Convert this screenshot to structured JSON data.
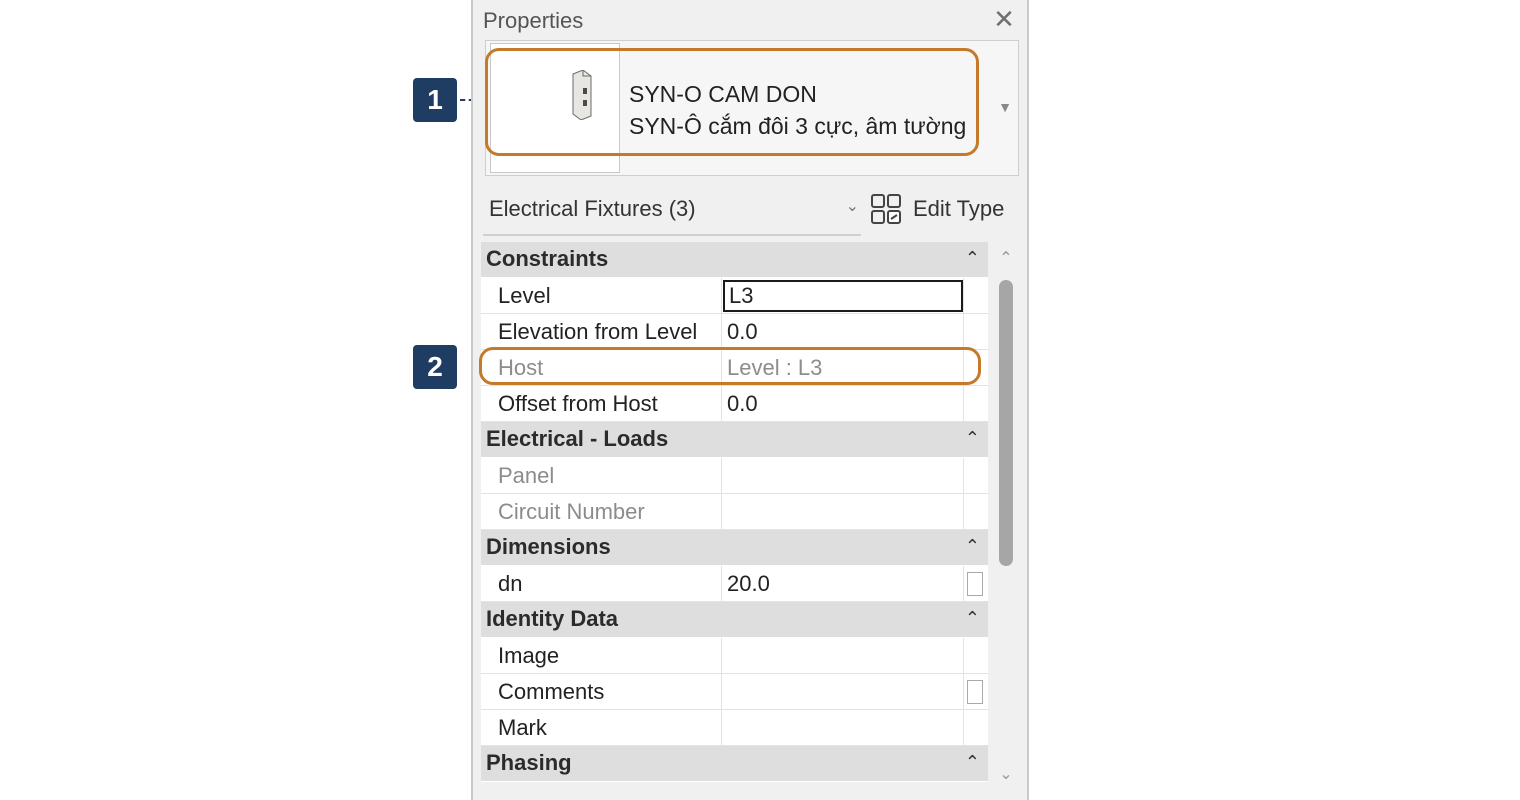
{
  "panel": {
    "title": "Properties",
    "close_symbol": "✕"
  },
  "type_selector": {
    "family_name": "SYN-O CAM DON",
    "type_name": "SYN-Ô cắm đôi 3 cực, âm tường"
  },
  "filter": {
    "label": "Electrical Fixtures (3)",
    "edit_type_label": "Edit Type"
  },
  "sections": {
    "constraints": {
      "label": "Constraints"
    },
    "electrical_loads": {
      "label": "Electrical - Loads"
    },
    "dimensions": {
      "label": "Dimensions"
    },
    "identity_data": {
      "label": "Identity Data"
    },
    "phasing": {
      "label": "Phasing"
    }
  },
  "rows": {
    "level": {
      "label": "Level",
      "value": "L3"
    },
    "elevation": {
      "label": "Elevation from Level",
      "value": "0.0"
    },
    "host": {
      "label": "Host",
      "value": "Level : L3"
    },
    "offset": {
      "label": "Offset from Host",
      "value": "0.0"
    },
    "panel": {
      "label": "Panel",
      "value": ""
    },
    "circuit": {
      "label": "Circuit Number",
      "value": ""
    },
    "dn": {
      "label": "dn",
      "value": "20.0"
    },
    "image": {
      "label": "Image",
      "value": ""
    },
    "comments": {
      "label": "Comments",
      "value": ""
    },
    "mark": {
      "label": "Mark",
      "value": ""
    }
  },
  "callouts": {
    "one": "1",
    "two": "2"
  },
  "icons": {
    "collapse": "collapse-section-icon",
    "dropdown": "chevron-down-icon",
    "edit_type": "edit-type-icon"
  },
  "colors": {
    "highlight": "#c47a2a",
    "callout": "#1f3d63"
  }
}
